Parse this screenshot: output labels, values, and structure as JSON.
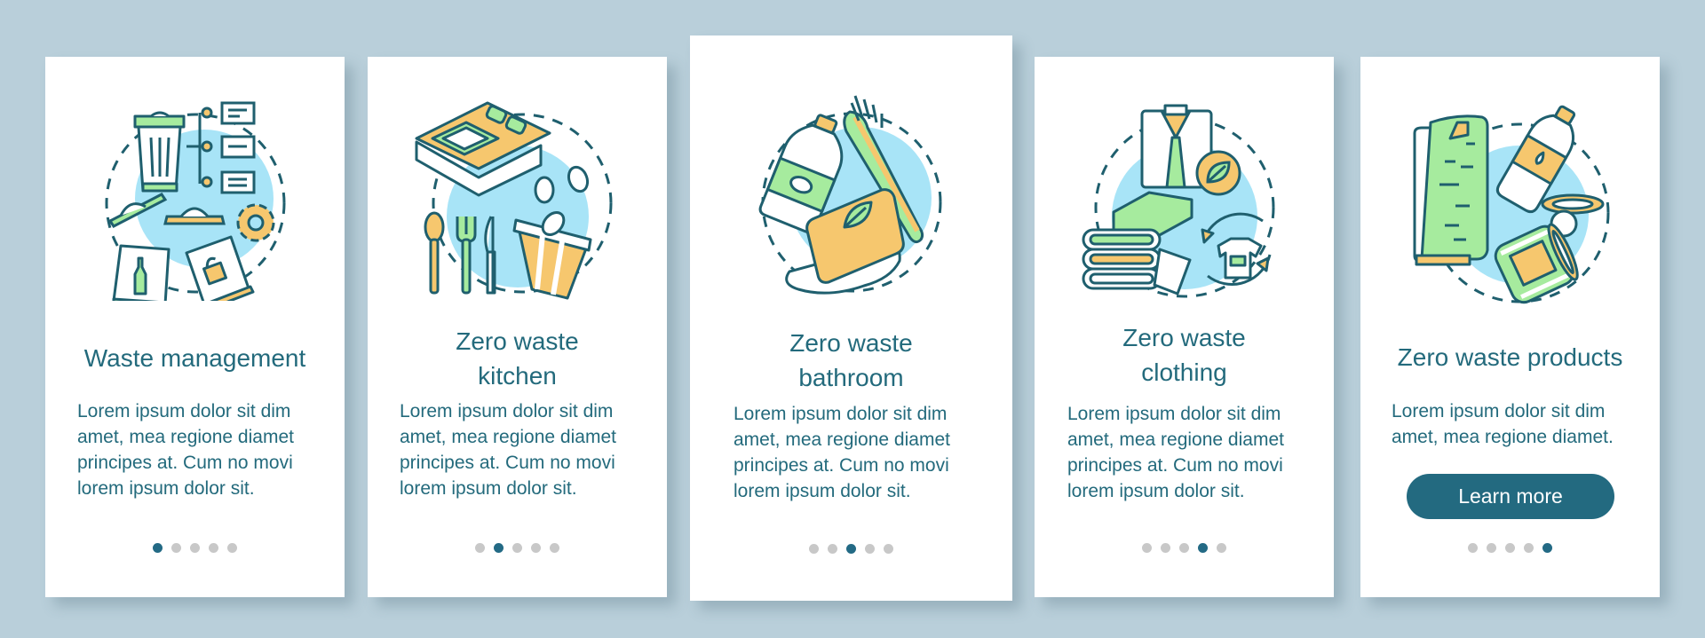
{
  "colors": {
    "background": "#b9cfda",
    "card": "#ffffff",
    "text": "#236a7c",
    "accent": "#236a85",
    "dot_inactive": "#c8c8c8",
    "illus_outline": "#1f5f6e",
    "illus_blue": "#a8e4f7",
    "illus_green": "#a6eb9e",
    "illus_orange": "#f6c76e"
  },
  "screens": [
    {
      "illustration": "waste-management-illustration",
      "title_lines": [
        "Waste management"
      ],
      "body_lines": [
        "Lorem ipsum dolor sit dim",
        "amet, mea regione diamet",
        "principes at. Cum no movi",
        "lorem ipsum dolor sit."
      ],
      "active_page": 1,
      "total_pages": 5
    },
    {
      "illustration": "zero-waste-kitchen-illustration",
      "title_lines": [
        "Zero waste",
        "kitchen"
      ],
      "body_lines": [
        "Lorem ipsum dolor sit dim",
        "amet, mea regione diamet",
        "principes at. Cum no movi",
        "lorem ipsum dolor sit."
      ],
      "active_page": 2,
      "total_pages": 5
    },
    {
      "illustration": "zero-waste-bathroom-illustration",
      "title_lines": [
        "Zero waste",
        "bathroom"
      ],
      "body_lines": [
        "Lorem ipsum dolor sit dim",
        "amet, mea regione diamet",
        "principes at. Cum no movi",
        "lorem ipsum dolor sit."
      ],
      "active_page": 3,
      "total_pages": 5
    },
    {
      "illustration": "zero-waste-clothing-illustration",
      "title_lines": [
        "Zero waste",
        "clothing"
      ],
      "body_lines": [
        "Lorem ipsum dolor sit dim",
        "amet, mea regione diamet",
        "principes at. Cum no movi",
        "lorem ipsum dolor sit."
      ],
      "active_page": 4,
      "total_pages": 5
    },
    {
      "illustration": "zero-waste-products-illustration",
      "title_lines": [
        "Zero waste products"
      ],
      "body_lines": [
        "Lorem ipsum dolor sit dim",
        "amet, mea regione diamet."
      ],
      "button_label": "Learn more",
      "active_page": 5,
      "total_pages": 5
    }
  ]
}
